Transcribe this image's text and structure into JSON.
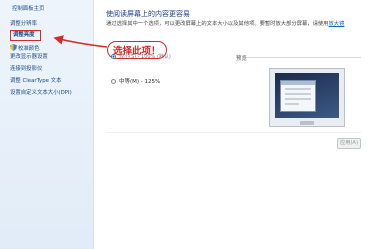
{
  "sidebar": {
    "items": [
      {
        "label": "控制面板主页"
      },
      {
        "label": "调整分辨率"
      },
      {
        "label": "调整亮度"
      },
      {
        "label": "校准颜色"
      },
      {
        "label": "更改显示器设置"
      },
      {
        "label": "连接到投影仪"
      },
      {
        "label": "调整 ClearType 文本"
      },
      {
        "label": "设置自定义文本大小(DPI)"
      }
    ]
  },
  "main": {
    "heading": "使阅读屏幕上的内容更容易",
    "description": "通过选择其中一个选项，可以更改屏幕上的文本大小以及其他项。要暂时放大部分屏幕，请使用",
    "description_link": "放大镜",
    "annotation": "选择此项！",
    "options": [
      {
        "label": "较小(S) - 100% (默认)",
        "checked": true
      },
      {
        "label": "中等(M) - 125%",
        "checked": false
      }
    ],
    "preview_label": "预览",
    "apply_button": "应用(A)"
  },
  "colors": {
    "annotation_red": "#d52a2a",
    "link_blue": "#1a5fb4",
    "sidebar_bg": "#e1ecf8"
  },
  "icons": [
    "shield-icon",
    "monitor-preview-icon",
    "arrow-annotation"
  ]
}
